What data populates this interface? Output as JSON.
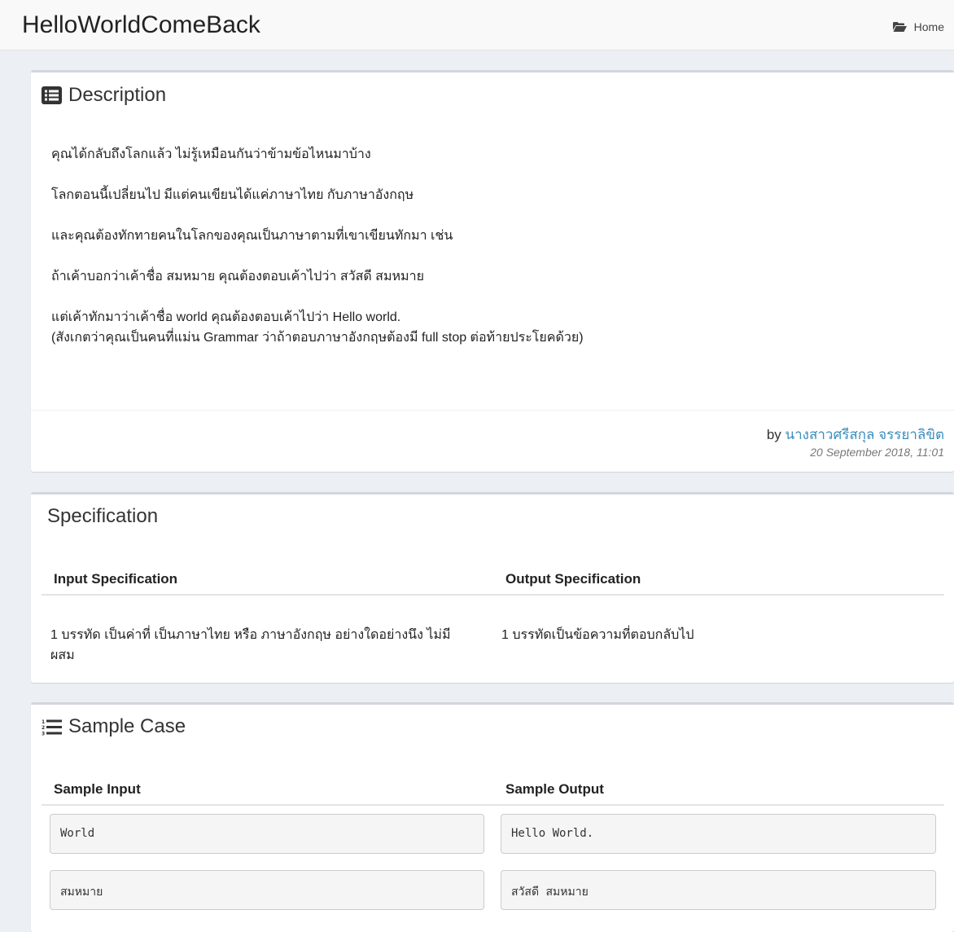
{
  "header": {
    "title": "HelloWorldComeBack",
    "breadcrumb": {
      "icon": "folder-open-icon",
      "label": "Home"
    }
  },
  "description": {
    "title": "Description",
    "icon": "list-alt-icon",
    "paragraphs": [
      "คุณได้กลับถึงโลกแล้ว ไม่รู้เหมือนกันว่าข้ามข้อไหนมาบ้าง",
      "โลกตอนนี้เปลี่ยนไป มีแต่คนเขียนได้แค่ภาษาไทย กับภาษาอังกฤษ",
      "และคุณต้องทักทายคนในโลกของคุณเป็นภาษาตามที่เขาเขียนทักมา เช่น",
      "ถ้าเค้าบอกว่าเค้าชื่อ สมหมาย คุณต้องตอบเค้าไปว่า สวัสดี สมหมาย",
      "แต่เค้าทักมาว่าเค้าชื่อ world คุณต้องตอบเค้าไปว่า Hello world.",
      "(สังเกตว่าคุณเป็นคนที่แม่น Grammar ว่าถ้าตอบภาษาอังกฤษต้องมี full stop ต่อท้ายประโยคด้วย)"
    ],
    "author_prefix": "by",
    "author_name": "นางสาวศรีสกุล จรรยาลิขิต",
    "date": "20 September 2018, 11:01"
  },
  "specification": {
    "title": "Specification",
    "input_header": "Input Specification",
    "output_header": "Output Specification",
    "input_text_line1": "1 บรรทัด เป็นค่าที่ เป็นภาษาไทย หรือ ภาษาอังกฤษ อย่างใดอย่างนึง ไม่มี",
    "input_text_line2": "ผสม",
    "output_text": "1 บรรทัดเป็นข้อความที่ตอบกลับไป"
  },
  "sample": {
    "title": "Sample Case",
    "icon": "list-ol-icon",
    "input_header": "Sample Input",
    "output_header": "Sample Output",
    "cases": [
      {
        "input": "World",
        "output": "Hello World."
      },
      {
        "input": "สมหมาย",
        "output": "สวัสดี สมหมาย"
      }
    ]
  },
  "colors": {
    "link": "#3c8dbc",
    "box_border": "#d2d6de",
    "background": "#ecf0f5"
  }
}
